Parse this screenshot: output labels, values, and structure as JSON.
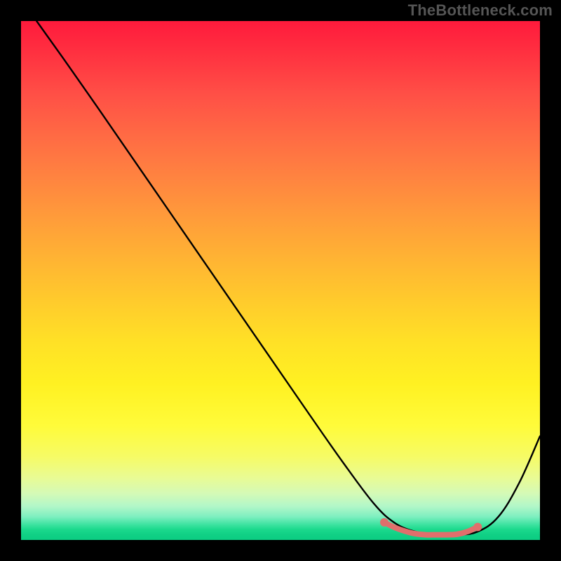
{
  "watermark": "TheBottleneck.com",
  "chart_data": {
    "type": "line",
    "title": "",
    "xlabel": "",
    "ylabel": "",
    "xlim": [
      0,
      100
    ],
    "ylim": [
      0,
      100
    ],
    "grid": false,
    "series": [
      {
        "name": "black-curve",
        "color": "#000000",
        "x": [
          3,
          8,
          15,
          25,
          35,
          45,
          55,
          62,
          68,
          72,
          76,
          80,
          84,
          88,
          92,
          96,
          100
        ],
        "y": [
          100,
          93,
          83,
          68.5,
          54,
          39.5,
          25,
          15,
          7,
          3.3,
          1.6,
          1.0,
          1.0,
          1.6,
          4.5,
          11,
          20
        ]
      },
      {
        "name": "pink-flat-segment",
        "color": "#e06f6c",
        "x": [
          70,
          72,
          74,
          76,
          78,
          80,
          82,
          84,
          86,
          88
        ],
        "y": [
          3.4,
          2.4,
          1.7,
          1.2,
          1.0,
          1.0,
          1.0,
          1.1,
          1.6,
          2.5
        ]
      }
    ],
    "dots": {
      "color": "#e06f6c",
      "x": [
        70,
        88
      ],
      "y": [
        3.4,
        2.5
      ]
    }
  }
}
